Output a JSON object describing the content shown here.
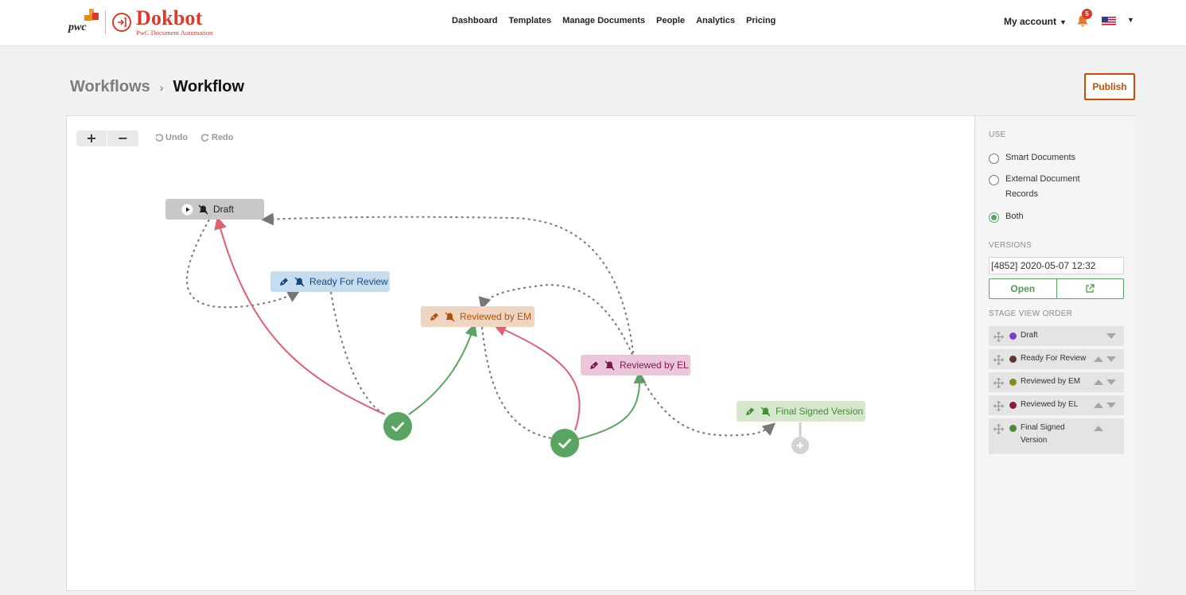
{
  "brand": {
    "partner": "pwc",
    "name": "Dokbot",
    "tagline": "PwC Document Automation"
  },
  "nav": {
    "items": [
      "Dashboard",
      "Templates",
      "Manage Documents",
      "People",
      "Analytics",
      "Pricing"
    ]
  },
  "account": {
    "label": "My account",
    "notification_count": "5",
    "language_flag": "us-flag-icon"
  },
  "breadcrumb": {
    "parent": "Workflows",
    "separator": "›",
    "current": "Workflow"
  },
  "actions": {
    "publish": "Publish"
  },
  "toolbar": {
    "zoom_in": "+",
    "zoom_out": "−",
    "undo": "Undo",
    "redo": "Redo"
  },
  "workflow": {
    "stages": [
      {
        "id": "draft",
        "label": "Draft",
        "color": "#c8c8c8",
        "icons": [
          "play-icon",
          "muted-bell-icon"
        ]
      },
      {
        "id": "review",
        "label": "Ready For Review",
        "color": "#c6dcef",
        "icons": [
          "pen-icon",
          "muted-bell-icon"
        ]
      },
      {
        "id": "em",
        "label": "Reviewed by EM",
        "color": "#f0d6c0",
        "icons": [
          "pen-icon",
          "muted-bell-icon"
        ]
      },
      {
        "id": "el",
        "label": "Reviewed by EL",
        "color": "#ecc7da",
        "icons": [
          "pen-icon",
          "muted-bell-icon"
        ]
      },
      {
        "id": "final",
        "label": "Final Signed Version",
        "color": "#d5e8cc",
        "icons": [
          "pen-icon",
          "muted-bell-icon"
        ]
      }
    ],
    "approval_nodes": [
      "check-icon",
      "check-icon"
    ],
    "edge_colors": {
      "reject": "#e06070",
      "approve": "#5aa461",
      "transition": "#777777"
    }
  },
  "panel": {
    "use_title": "USE",
    "use_options": [
      {
        "label": "Smart Documents",
        "selected": false
      },
      {
        "label": "External Document Records",
        "selected": false
      },
      {
        "label": "Both",
        "selected": true
      }
    ],
    "versions_title": "VERSIONS",
    "version_value": "[4852] 2020-05-07 12:32",
    "open_label": "Open",
    "order_title": "STAGE VIEW ORDER",
    "order": [
      {
        "label": "Draft",
        "color": "#7b3fc4",
        "up": false,
        "down": true
      },
      {
        "label": "Ready For Review",
        "color": "#5a3a2e",
        "up": true,
        "down": true
      },
      {
        "label": "Reviewed by EM",
        "color": "#8a8a1e",
        "up": true,
        "down": true
      },
      {
        "label": "Reviewed by EL",
        "color": "#8a1a4a",
        "up": true,
        "down": true
      },
      {
        "label": "Final Signed Version",
        "color": "#4a8a38",
        "up": true,
        "down": false
      }
    ]
  },
  "colors": {
    "brand_red": "#d93a2b",
    "publish_orange": "#d04a02",
    "accent_green": "#5aa461"
  }
}
